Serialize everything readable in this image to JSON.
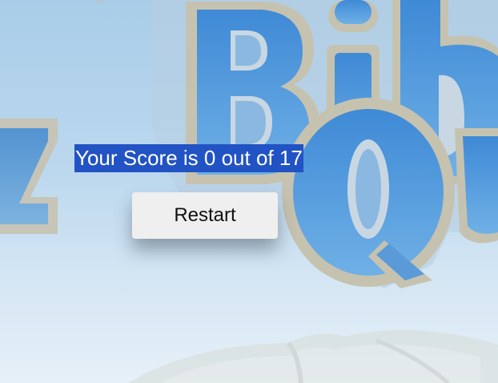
{
  "score": {
    "text": "Your Score is 0 out of 17"
  },
  "restart_button": {
    "label": "Restart"
  },
  "colors": {
    "selection_highlight": "#2153c4",
    "button_bg": "#efefef",
    "logo_blue": "#4a8fd4",
    "logo_outline": "#c9c5b6"
  },
  "background": {
    "logo_icon": "bible-quiz-logo-icon",
    "book_icon": "open-book-icon"
  }
}
